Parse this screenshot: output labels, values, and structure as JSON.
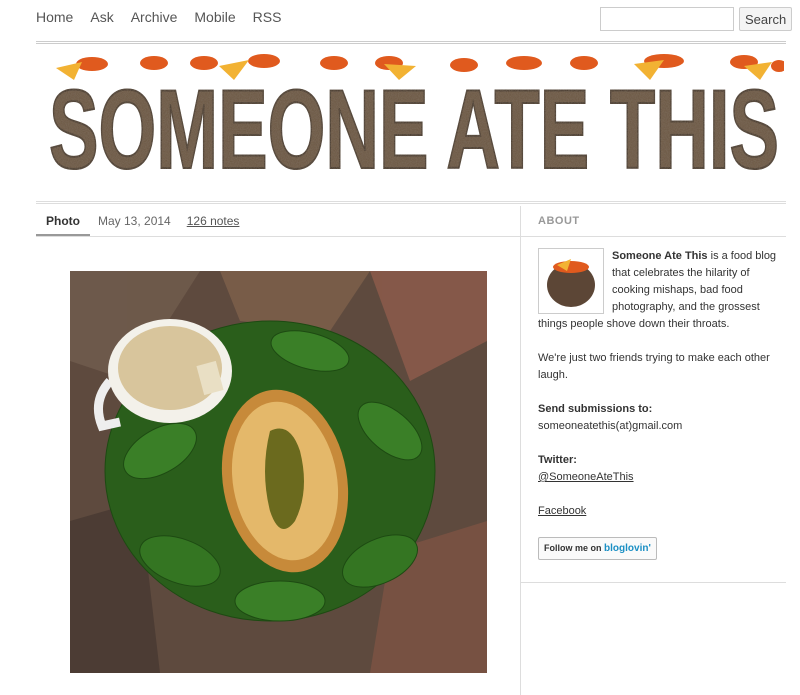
{
  "nav": {
    "items": [
      "Home",
      "Ask",
      "Archive",
      "Mobile",
      "RSS"
    ]
  },
  "search": {
    "button_label": "Search",
    "value": ""
  },
  "banner": {
    "title": "SOMEONE ATE THIS"
  },
  "post": {
    "type": "Photo",
    "date": "May 13, 2014",
    "notes": "126 notes"
  },
  "about": {
    "heading": "ABOUT",
    "site_name": "Someone Ate This",
    "intro": " is a food blog that celebrates the hilarity of cooking mishaps, bad food photography, and the grossest things people shove down their throats.",
    "tagline": "We're just two friends trying to make each other laugh.",
    "submissions_label": "Send submissions to:",
    "submissions_email": "someoneatethis(at)gmail.com",
    "twitter_label": "Twitter:",
    "twitter_handle": "@SomeoneAteThis",
    "facebook": "Facebook",
    "bloglovin_prefix": "Follow me on",
    "bloglovin_brand": "bloglovin'"
  },
  "colors": {
    "banner_text": "#6b5440",
    "banner_topping": "#e05a1e",
    "cheese": "#f2b233"
  }
}
